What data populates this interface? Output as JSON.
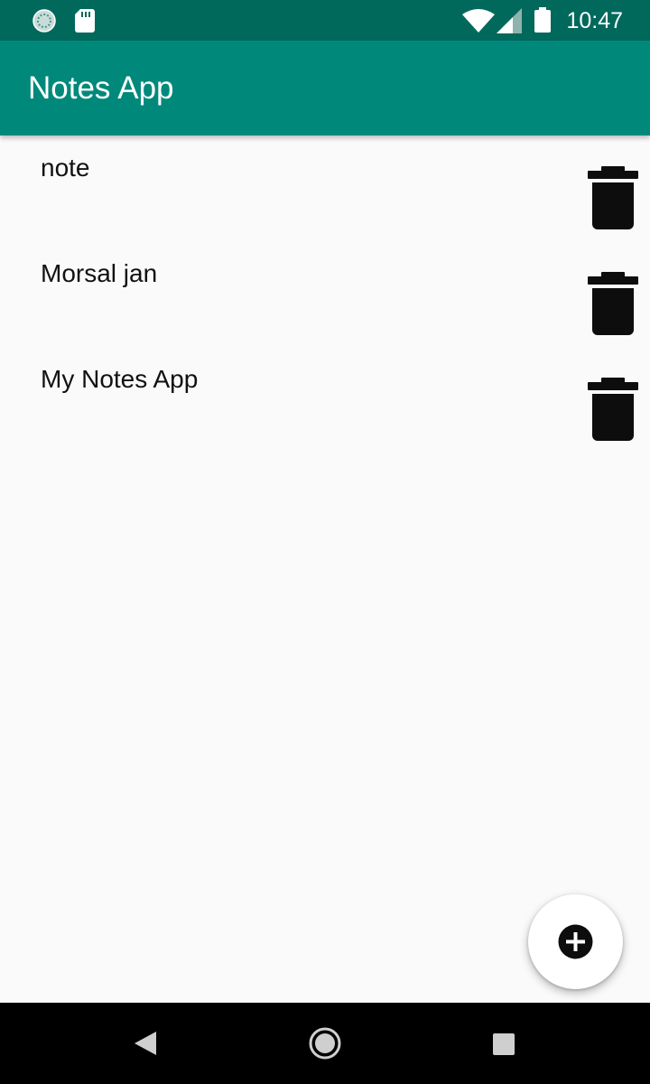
{
  "status_bar": {
    "time": "10:47",
    "icons": [
      "sync-icon",
      "sd-card-icon",
      "wifi-icon",
      "signal-icon",
      "battery-icon"
    ]
  },
  "app_bar": {
    "title": "Notes App",
    "color": "#00897b",
    "status_color": "#00695c"
  },
  "notes": [
    {
      "title": "note"
    },
    {
      "title": "Morsal jan"
    },
    {
      "title": "My Notes App"
    }
  ],
  "fab": {
    "icon": "add-circle-icon"
  },
  "nav_bar": {
    "buttons": [
      "back-icon",
      "home-icon",
      "recents-icon"
    ]
  }
}
